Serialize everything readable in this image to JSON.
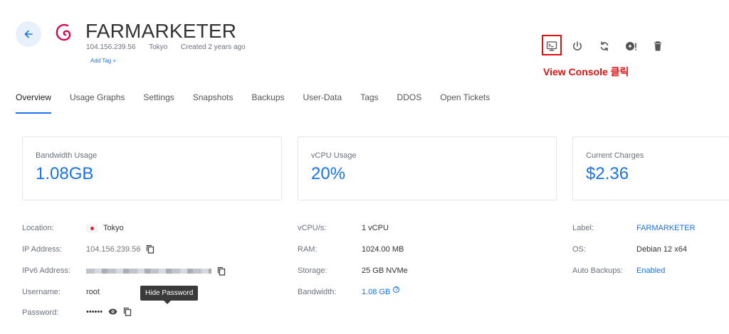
{
  "server": {
    "title": "FARMARKETER",
    "ip": "104.156.239.56",
    "location": "Tokyo",
    "created": "Created 2 years ago",
    "add_tag": "Add Tag +"
  },
  "annotation": "View Console 클릭",
  "tabs": [
    {
      "label": "Overview",
      "active": true
    },
    {
      "label": "Usage Graphs"
    },
    {
      "label": "Settings"
    },
    {
      "label": "Snapshots"
    },
    {
      "label": "Backups"
    },
    {
      "label": "User-Data"
    },
    {
      "label": "Tags"
    },
    {
      "label": "DDOS"
    },
    {
      "label": "Open Tickets"
    }
  ],
  "cards": {
    "bandwidth": {
      "label": "Bandwidth Usage",
      "value": "1.08GB"
    },
    "vcpu": {
      "label": "vCPU Usage",
      "value": "20%"
    },
    "charges": {
      "label": "Current Charges",
      "value": "$2.36"
    }
  },
  "details": {
    "location": {
      "label": "Location:",
      "value": "Tokyo"
    },
    "ip": {
      "label": "IP Address:",
      "value": "104.156.239.56"
    },
    "ipv6": {
      "label": "IPv6 Address:"
    },
    "username": {
      "label": "Username:",
      "value": "root"
    },
    "password": {
      "label": "Password:",
      "value": "••••••"
    },
    "vcpus": {
      "label": "vCPU/s:",
      "value": "1 vCPU"
    },
    "ram": {
      "label": "RAM:",
      "value": "1024.00 MB"
    },
    "storage": {
      "label": "Storage:",
      "value": "25 GB NVMe"
    },
    "bandwidth": {
      "label": "Bandwidth:",
      "value": "1.08 GB"
    },
    "label": {
      "label": "Label:",
      "value": "FARMARKETER"
    },
    "os": {
      "label": "OS:",
      "value": "Debian 12 x64"
    },
    "backups": {
      "label": "Auto Backups:",
      "value": "Enabled"
    }
  },
  "tooltip": "Hide Password",
  "help_mark": "?",
  "colors": {
    "accent": "#1a73e8",
    "annotation": "#e01010",
    "debian": "#d70751"
  },
  "icons": [
    "back-arrow-icon",
    "debian-logo-icon",
    "console-icon",
    "power-icon",
    "restart-icon",
    "reinstall-icon",
    "trash-icon",
    "copy-icon",
    "eye-icon"
  ]
}
